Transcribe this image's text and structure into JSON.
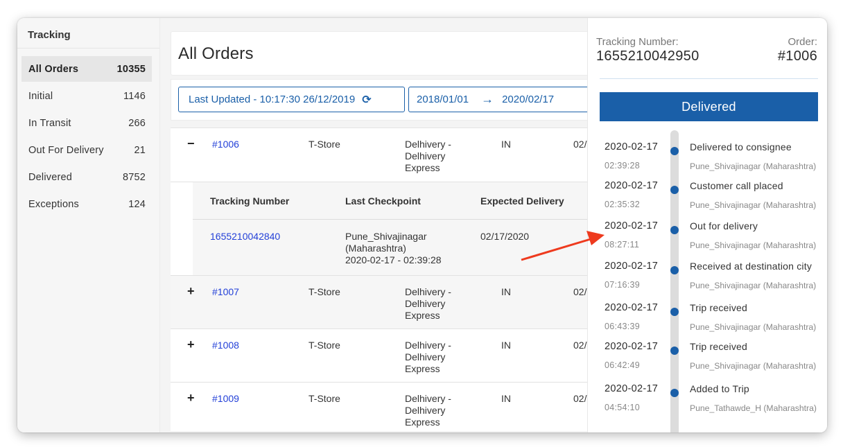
{
  "sidebar": {
    "title": "Tracking",
    "items": [
      {
        "label": "All Orders",
        "count": "10355",
        "active": true
      },
      {
        "label": "Initial",
        "count": "1146"
      },
      {
        "label": "In Transit",
        "count": "266"
      },
      {
        "label": "Out For Delivery",
        "count": "21"
      },
      {
        "label": "Delivered",
        "count": "8752"
      },
      {
        "label": "Exceptions",
        "count": "124"
      }
    ]
  },
  "main": {
    "title": "All Orders",
    "last_updated": "Last Updated - 10:17:30 26/12/2019",
    "refresh_icon": "refresh-icon",
    "date_from": "2018/01/01",
    "date_arrow": "→",
    "date_to": "2020/02/17",
    "orders": [
      {
        "toggle": "−",
        "id": "#1006",
        "store": "T-Store",
        "carrier": "Delhivery - Delhivery Express",
        "country": "IN",
        "date": "02/"
      },
      {
        "toggle": "+",
        "id": "#1007",
        "store": "T-Store",
        "carrier": "Delhivery - Delhivery Express",
        "country": "IN",
        "date": "02/"
      },
      {
        "toggle": "+",
        "id": "#1008",
        "store": "T-Store",
        "carrier": "Delhivery - Delhivery Express",
        "country": "IN",
        "date": "02/"
      },
      {
        "toggle": "+",
        "id": "#1009",
        "store": "T-Store",
        "carrier": "Delhivery - Delhivery Express",
        "country": "IN",
        "date": "02/"
      }
    ],
    "expanded": {
      "headers": {
        "tracking": "Tracking Number",
        "checkpoint": "Last Checkpoint",
        "expected": "Expected Delivery"
      },
      "row": {
        "tracking": "1655210042840",
        "checkpoint_line1": "Pune_Shivajinagar",
        "checkpoint_line2": "(Maharashtra)",
        "checkpoint_line3": "2020-02-17 - 02:39:28",
        "expected": "02/17/2020"
      }
    }
  },
  "panel": {
    "tracking_label": "Tracking Number:",
    "tracking_value": "1655210042950",
    "order_label": "Order:",
    "order_value": "#1006",
    "status": "Delivered",
    "status_color": "#1a5fa8",
    "events": [
      {
        "date": "2020-02-17",
        "time": "02:39:28",
        "desc": "Delivered to consignee",
        "loc": "Pune_Shivajinagar (Maharashtra)"
      },
      {
        "date": "2020-02-17",
        "time": "02:35:32",
        "desc": "Customer call placed",
        "loc": "Pune_Shivajinagar (Maharashtra)"
      },
      {
        "date": "2020-02-17",
        "time": "08:27:11",
        "desc": "Out for delivery",
        "loc": "Pune_Shivajinagar (Maharashtra)"
      },
      {
        "date": "2020-02-17",
        "time": "07:16:39",
        "desc": "Received at destination city",
        "loc": "Pune_Shivajinagar (Maharashtra)"
      },
      {
        "date": "2020-02-17",
        "time": "06:43:39",
        "desc": "Trip received",
        "loc": "Pune_Shivajinagar (Maharashtra)"
      },
      {
        "date": "2020-02-17",
        "time": "06:42:49",
        "desc": "Trip received",
        "loc": "Pune_Shivajinagar (Maharashtra)"
      },
      {
        "date": "2020-02-17",
        "time": "04:54:10",
        "desc": "Added to Trip",
        "loc": "Pune_Tathawde_H (Maharashtra)"
      }
    ]
  },
  "annotation": {
    "type": "red-arrow",
    "color": "#ee3a1e"
  }
}
